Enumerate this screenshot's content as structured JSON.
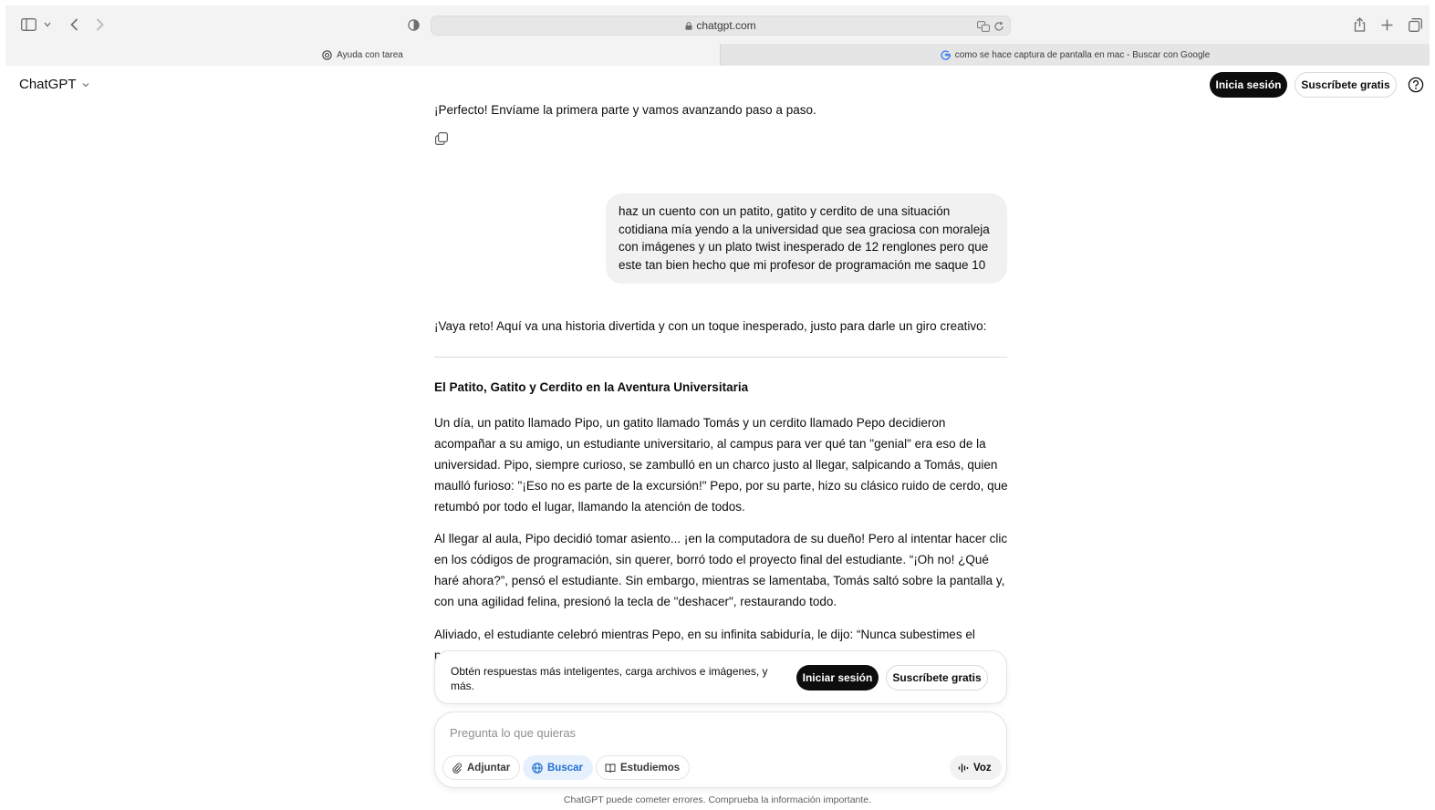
{
  "browser": {
    "url": "chatgpt.com",
    "tabs": [
      {
        "label": "Ayuda con tarea",
        "active": true
      },
      {
        "label": "como se hace captura de pantalla en mac - Buscar con Google",
        "active": false
      }
    ]
  },
  "header": {
    "title": "ChatGPT",
    "login_label": "Inicia sesión",
    "signup_label": "Suscríbete gratis"
  },
  "conversation": {
    "assistant_intro": "¡Perfecto! Envíame la primera parte y vamos avanzando paso a paso.",
    "user_message": "haz un cuento con un patito, gatito y cerdito de una situación cotidiana mía yendo a la universidad que sea graciosa con moraleja con imágenes y un plato twist inesperado de 12 renglones pero que este tan bien hecho que mi profesor de programación me saque 10",
    "assistant_reply_intro": "¡Vaya reto! Aquí va una historia divertida y con un toque inesperado, justo para darle un giro creativo:",
    "story_title": "El Patito, Gatito y Cerdito en la Aventura Universitaria",
    "paragraphs": [
      "Un día, un patito llamado Pipo, un gatito llamado Tomás y un cerdito llamado Pepo decidieron acompañar a su amigo, un estudiante universitario, al campus para ver qué tan \"genial\" era eso de la universidad. Pipo, siempre curioso, se zambulló en un charco justo al llegar, salpicando a Tomás, quien maulló furioso: \"¡Eso no es parte de la excursión!\" Pepo, por su parte, hizo su clásico ruido de cerdo, que retumbó por todo el lugar, llamando la atención de todos.",
      "Al llegar al aula, Pipo decidió tomar asiento... ¡en la computadora de su dueño! Pero al intentar hacer clic en los códigos de programación, sin querer, borró todo el proyecto final del estudiante. “¡Oh no! ¿Qué haré ahora?”, pensó el estudiante. Sin embargo, mientras se lamentaba, Tomás saltó sobre la pantalla y, con una agilidad felina, presionó la tecla de \"deshacer\", restaurando todo.",
      "Aliviado, el estudiante celebró mientras Pepo, en su infinita sabiduría, le dijo: “Nunca subestimes el poder"
    ]
  },
  "login_banner": {
    "text": "Obtén respuestas más inteligentes, carga archivos e imágenes, y más.",
    "login_label": "Iniciar sesión",
    "signup_label": "Suscríbete gratis"
  },
  "composer": {
    "placeholder": "Pregunta lo que quieras",
    "attach_label": "Adjuntar",
    "search_label": "Buscar",
    "study_label": "Estudiemos",
    "voice_label": "Voz"
  },
  "footer": {
    "note": "ChatGPT puede cometer errores. Comprueba la información importante."
  },
  "colors": {
    "accent": "#1f6fd0",
    "dark_button": "#0d0d0d"
  }
}
